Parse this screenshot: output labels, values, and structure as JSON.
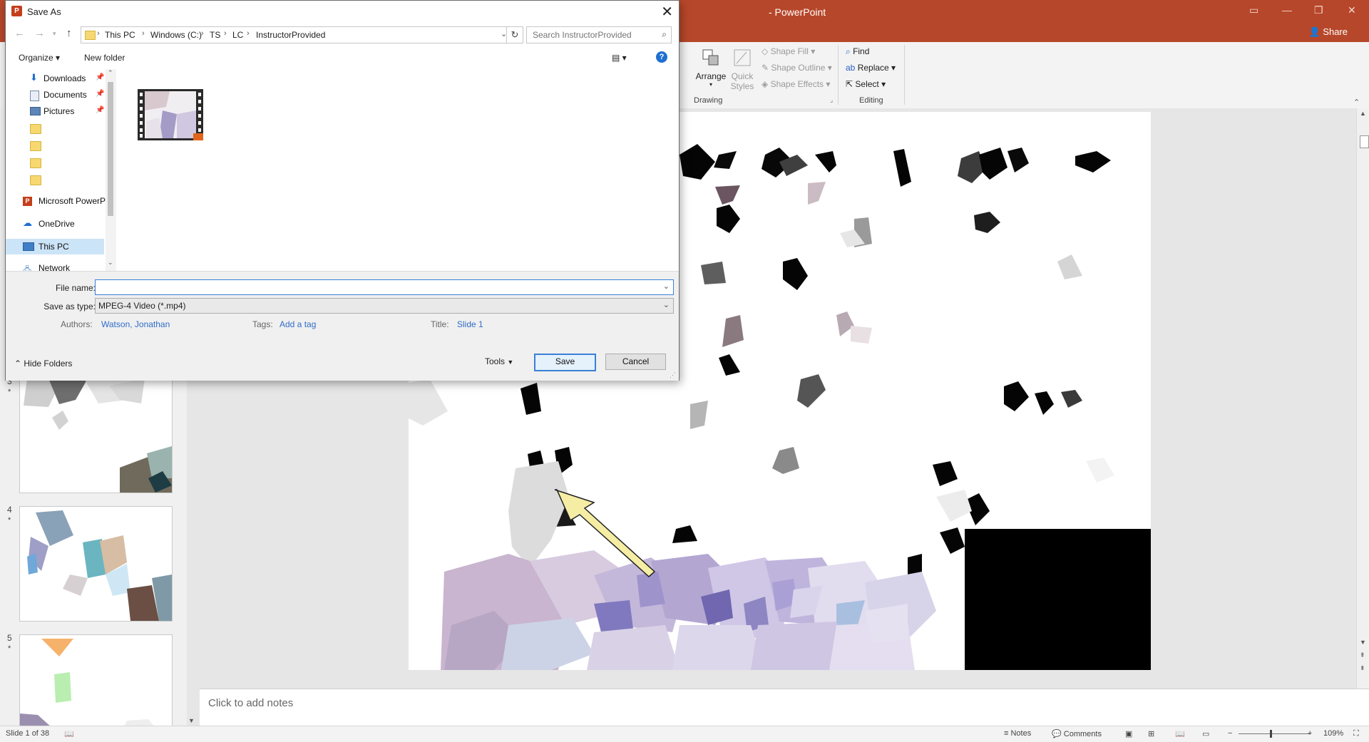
{
  "app": {
    "title": "- PowerPoint",
    "share_label": "Share",
    "window_controls": [
      "ribbon-display-icon",
      "minimize-icon",
      "restore-icon",
      "close-icon"
    ]
  },
  "ribbon": {
    "arrange": "Arrange",
    "quick_styles": "Quick Styles",
    "shape_fill": "Shape Fill",
    "shape_outline": "Shape Outline",
    "shape_effects": "Shape Effects",
    "find": "Find",
    "replace": "Replace",
    "select": "Select",
    "group_drawing": "Drawing",
    "group_editing": "Editing"
  },
  "thumbnails": [
    {
      "num": "3",
      "star": "*"
    },
    {
      "num": "4",
      "star": "*"
    },
    {
      "num": "5",
      "star": "*"
    }
  ],
  "notes": {
    "placeholder": "Click to add notes"
  },
  "status": {
    "slide_info": "Slide 1 of 38",
    "notes": "Notes",
    "comments": "Comments",
    "zoom": "109%",
    "zoom_minus": "−",
    "zoom_plus": "+"
  },
  "dialog": {
    "title": "Save As",
    "breadcrumb": [
      "This PC",
      "Windows (C:)",
      "TS",
      "LC",
      "InstructorProvided"
    ],
    "search_placeholder": "Search InstructorProvided",
    "organize": "Organize",
    "new_folder": "New folder",
    "nav_items": [
      {
        "label": "Downloads",
        "icon": "download-arrow-icon"
      },
      {
        "label": "Documents",
        "icon": "document-icon"
      },
      {
        "label": "Pictures",
        "icon": "pictures-icon"
      },
      {
        "label": "",
        "icon": "folder-icon"
      },
      {
        "label": "",
        "icon": "folder-icon"
      },
      {
        "label": "",
        "icon": "folder-icon"
      },
      {
        "label": "",
        "icon": "folder-icon"
      },
      {
        "label": "Microsoft PowerP",
        "icon": "powerpoint-icon"
      },
      {
        "label": "OneDrive",
        "icon": "cloud-icon"
      },
      {
        "label": "This PC",
        "icon": "computer-icon",
        "selected": true
      },
      {
        "label": "Network",
        "icon": "network-icon"
      }
    ],
    "file_name_label": "File name:",
    "file_name_value": "",
    "save_type_label": "Save as type:",
    "save_type_value": "MPEG-4 Video (*.mp4)",
    "authors_label": "Authors:",
    "authors_value": "Watson, Jonathan",
    "tags_label": "Tags:",
    "tags_value": "Add a tag",
    "title_label": "Title:",
    "title_value": "Slide 1",
    "hide_folders": "Hide Folders",
    "tools": "Tools",
    "save": "Save",
    "cancel": "Cancel"
  },
  "colors": {
    "ppt_accent": "#b7472a",
    "dialog_link": "#2f6cc9",
    "primary_border": "#3a80d6",
    "arrow_fill": "#f5eda4"
  }
}
